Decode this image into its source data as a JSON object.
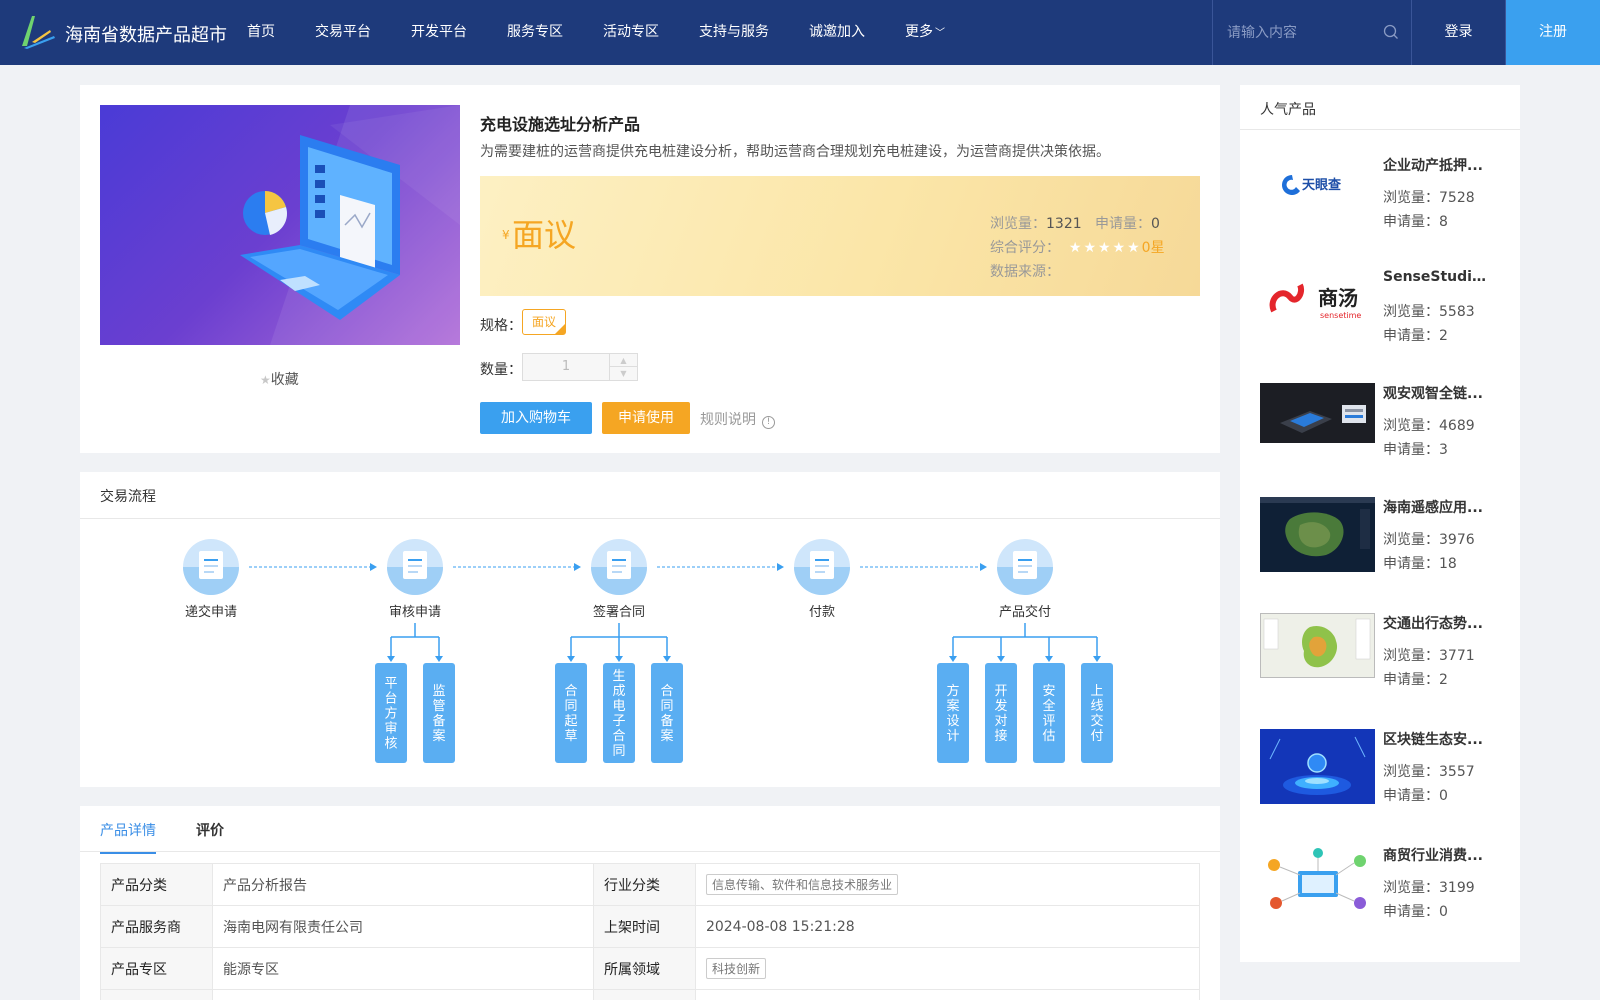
{
  "header": {
    "brand": "海南省数据产品超市",
    "nav": [
      "首页",
      "交易平台",
      "开发平台",
      "服务专区",
      "活动专区",
      "支持与服务",
      "诚邀加入",
      "更多"
    ],
    "search_placeholder": "请输入内容",
    "login": "登录",
    "register": "注册"
  },
  "product": {
    "title": "充电设施选址分析产品",
    "description": "为需要建桩的运营商提供充电桩建设分析，帮助运营商合理规划充电桩建设，为运营商提供决策依据。",
    "currency": "¥",
    "price": "面议",
    "views_label": "浏览量：",
    "views": "1321",
    "applies_label": "申请量：",
    "applies": "0",
    "rating_label": "综合评分：",
    "rating": "0星",
    "source_label": "数据来源：",
    "spec_label": "规格：",
    "spec_value": "面议",
    "qty_label": "数量：",
    "qty_value": "1",
    "favorite": "收藏",
    "add_to_cart": "加入购物车",
    "apply": "申请使用",
    "rules": "规则说明"
  },
  "flow": {
    "title": "交易流程",
    "steps": [
      "递交申请",
      "审核申请",
      "签署合同",
      "付款",
      "产品交付"
    ],
    "subs": {
      "审核申请": [
        "平台方审核",
        "监管备案"
      ],
      "签署合同": [
        "合同起草",
        "生成电子合同",
        "合同备案"
      ],
      "产品交付": [
        "方案设计",
        "开发对接",
        "安全评估",
        "上线交付"
      ]
    }
  },
  "details": {
    "tabs": [
      "产品详情",
      "评价"
    ],
    "rows": [
      {
        "k1": "产品分类",
        "v1": "产品分析报告",
        "k2": "行业分类",
        "v2": "信息传输、软件和信息技术服务业"
      },
      {
        "k1": "产品服务商",
        "v1": "海南电网有限责任公司",
        "k2": "上架时间",
        "v2": "2024-08-08 15:21:28"
      },
      {
        "k1": "产品专区",
        "v1": "能源专区",
        "k2": "所属领域",
        "v2": "科技创新"
      }
    ]
  },
  "sidebar": {
    "title": "人气产品",
    "items": [
      {
        "name": "企业动产抵押...",
        "views": "浏览量：7528",
        "applies": "申请量：8",
        "logo_text": "天眼查"
      },
      {
        "name": "SenseStudio...",
        "views": "浏览量：5583",
        "applies": "申请量：2",
        "logo_text": "商汤",
        "logo_sub": "sensetime"
      },
      {
        "name": "观安观智全链...",
        "views": "浏览量：4689",
        "applies": "申请量：3"
      },
      {
        "name": "海南遥感应用...",
        "views": "浏览量：3976",
        "applies": "申请量：18"
      },
      {
        "name": "交通出行态势...",
        "views": "浏览量：3771",
        "applies": "申请量：2"
      },
      {
        "name": "区块链生态安...",
        "views": "浏览量：3557",
        "applies": "申请量：0"
      },
      {
        "name": "商贸行业消费...",
        "views": "浏览量：3199",
        "applies": "申请量：0"
      }
    ]
  },
  "colors": {
    "header": "#1e3a7b",
    "primary": "#3aa0ef",
    "accent": "#f5a623"
  }
}
